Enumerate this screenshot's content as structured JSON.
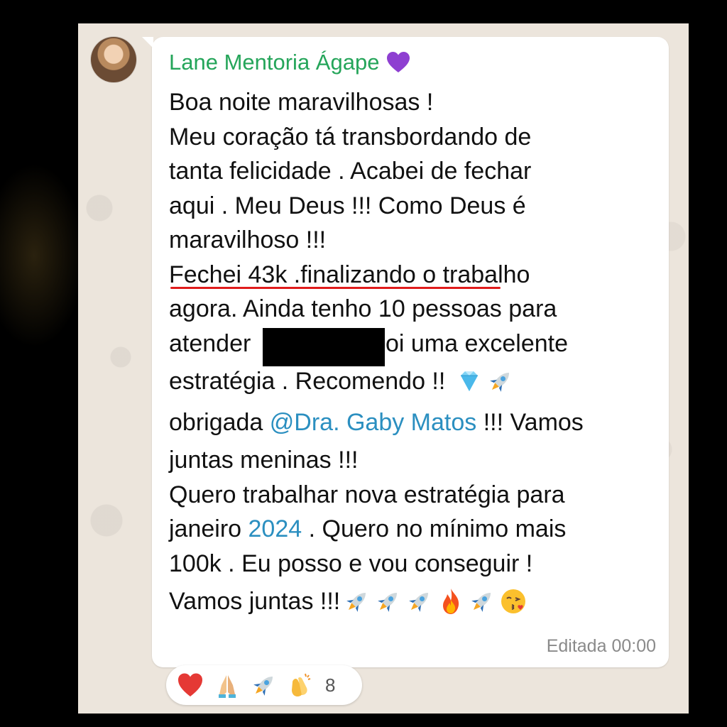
{
  "message": {
    "sender": "Lane Mentoria Ágape",
    "lines_a": [
      "Boa noite maravilhosas !",
      "Meu coração tá transbordando de",
      "tanta felicidade . Acabei de fechar",
      "aqui .  Meu Deus !!! Como Deus é",
      "maravilhoso !!!",
      "Fechei 43k .finalizando o trabalho",
      "agora. Ainda tenho 10 pessoas para"
    ],
    "line_redacted_before": "atender",
    "line_redacted_after": ". Foi uma excelente",
    "line_recommend": "estratégia . Recomendo !! ",
    "line_thanks_before": "obrigada ",
    "mention": "@Dra. Gaby Matos",
    "line_thanks_after": " !!! Vamos",
    "line_juntas": "juntas meninas !!!",
    "line_quero": "Quero trabalhar nova estratégia para",
    "line_janeiro_before": "janeiro ",
    "year_link": "2024",
    "line_janeiro_after": " . Quero no mínimo mais",
    "line_100k": "100k . Eu posso e vou conseguir !",
    "line_final": "Vamos juntas !!!",
    "edited_label": "Editada 00:00"
  },
  "reactions": {
    "icons": [
      "red-heart-icon",
      "folded-hands-icon",
      "rocket-icon",
      "clapping-hands-icon"
    ],
    "count": "8"
  },
  "colors": {
    "sender": "#25a55a",
    "mention": "#2b8fc0",
    "underline": "#e01c1c",
    "chat_background": "#ece5dc"
  }
}
